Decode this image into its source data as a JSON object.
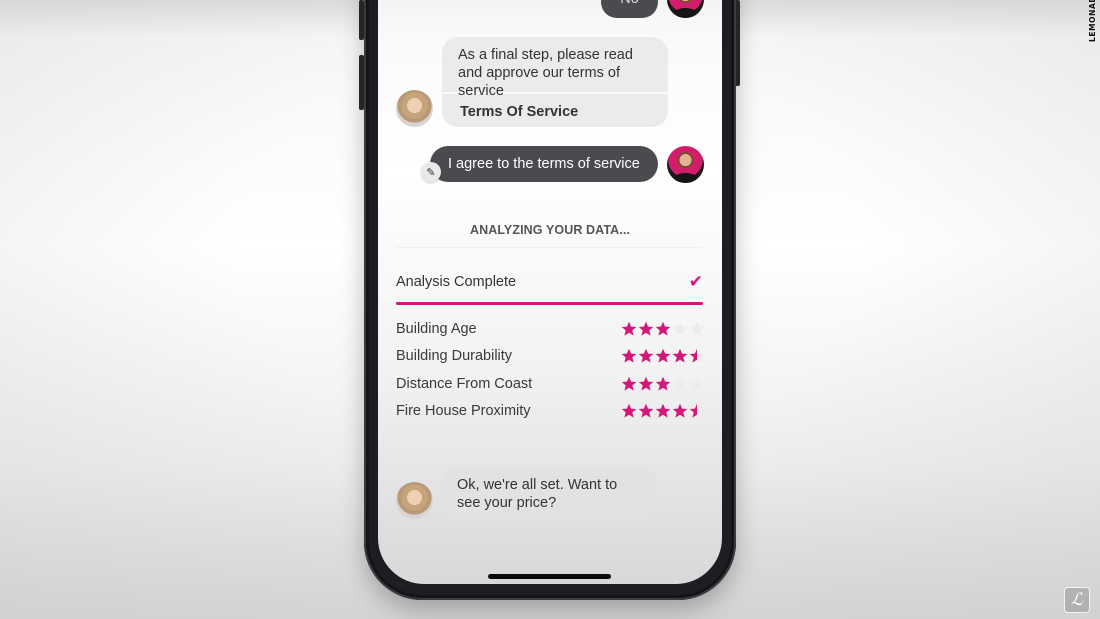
{
  "watermark": {
    "brand_text": "LEMONADE",
    "logo_glyph": "ℒ"
  },
  "chat": {
    "previous_user_reply": "No",
    "bot_message_1": {
      "text": "As a final step, please read and approve our terms of service",
      "link_label": "Terms Of Service"
    },
    "user_reply_1": {
      "text": "I agree to the terms of service",
      "edit_icon": "pencil-icon"
    },
    "analysis": {
      "heading": "ANALYZING YOUR DATA...",
      "status_label": "Analysis Complete",
      "status_icon": "checkmark-icon",
      "progress_percent": 100,
      "accent_color": "#d4177a",
      "ratings": [
        {
          "label": "Building Age",
          "stars": 3,
          "max": 5
        },
        {
          "label": "Building Durability",
          "stars": 4.5,
          "max": 5
        },
        {
          "label": "Distance From Coast",
          "stars": 3,
          "max": 5
        },
        {
          "label": "Fire House Proximity",
          "stars": 4.5,
          "max": 5
        }
      ]
    },
    "bot_message_2": {
      "text": "Ok, we're all set. Want to see your price?"
    }
  }
}
